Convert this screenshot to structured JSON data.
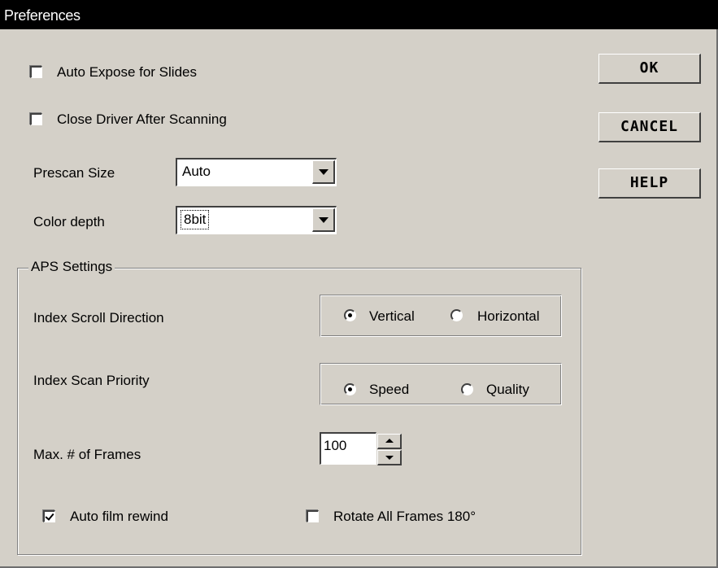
{
  "window": {
    "title": "Preferences"
  },
  "options": {
    "auto_expose": {
      "label": "Auto Expose for Slides",
      "checked": false
    },
    "close_driver": {
      "label": "Close Driver After Scanning",
      "checked": false
    }
  },
  "prescan": {
    "label": "Prescan Size",
    "value": "Auto"
  },
  "color_depth": {
    "label": "Color depth",
    "value": "8bit"
  },
  "buttons": {
    "ok": "OK",
    "cancel": "CANCEL",
    "help": "HELP"
  },
  "aps": {
    "legend": "APS Settings",
    "scroll_direction": {
      "label": "Index Scroll Direction",
      "option1": "Vertical",
      "option2": "Horizontal",
      "selected": "Vertical"
    },
    "scan_priority": {
      "label": "Index Scan Priority",
      "option1": "Speed",
      "option2": "Quality",
      "selected": "Speed"
    },
    "max_frames": {
      "label": "Max. # of Frames",
      "value": "100"
    },
    "auto_rewind": {
      "label": "Auto film rewind",
      "checked": true
    },
    "rotate": {
      "label": "Rotate All Frames 180°",
      "checked": false
    }
  }
}
